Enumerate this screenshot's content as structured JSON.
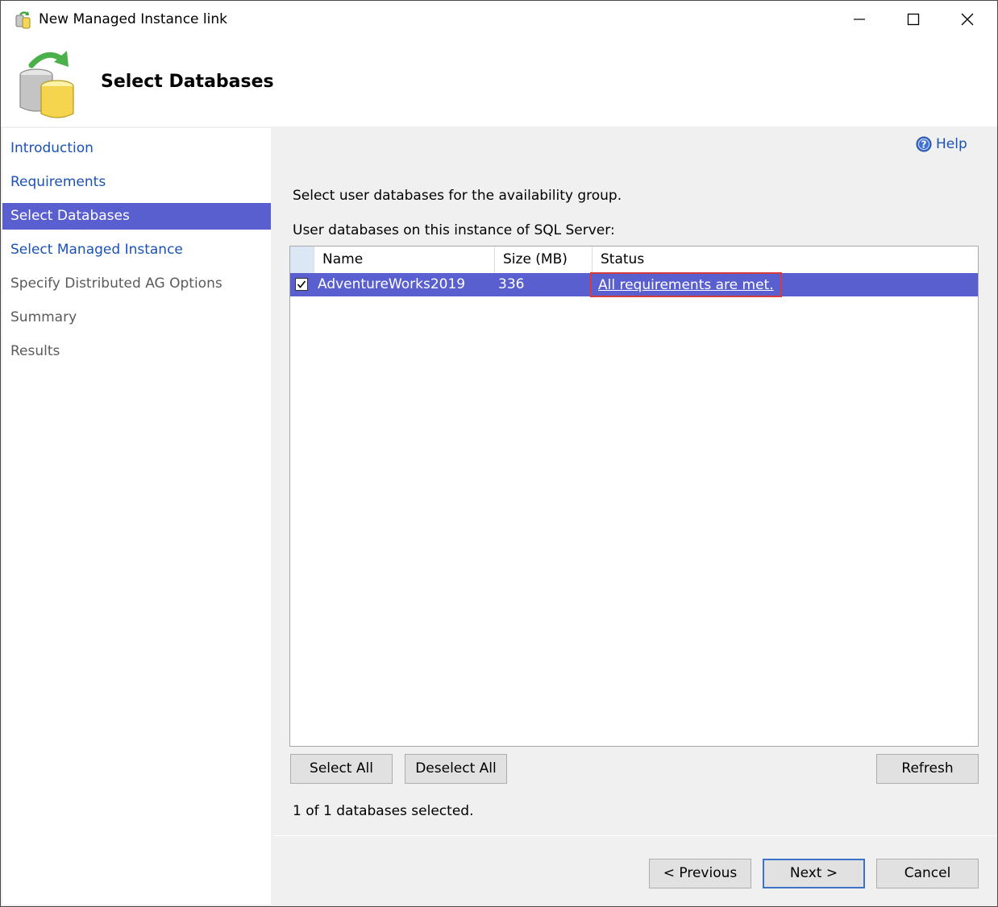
{
  "window": {
    "title": "New Managed Instance link"
  },
  "header": {
    "title": "Select Databases"
  },
  "sidebar": {
    "items": [
      {
        "label": "Introduction",
        "state": "link"
      },
      {
        "label": "Requirements",
        "state": "link"
      },
      {
        "label": "Select Databases",
        "state": "selected"
      },
      {
        "label": "Select Managed Instance",
        "state": "link"
      },
      {
        "label": "Specify Distributed AG Options",
        "state": "disabled"
      },
      {
        "label": "Summary",
        "state": "disabled"
      },
      {
        "label": "Results",
        "state": "disabled"
      }
    ]
  },
  "main": {
    "help_label": "Help",
    "intro": "Select user databases for the availability group.",
    "list_label": "User databases on this instance of SQL Server:",
    "columns": [
      "Name",
      "Size (MB)",
      "Status"
    ],
    "rows": [
      {
        "checked": true,
        "name": "AdventureWorks2019",
        "size": "336",
        "status": "All requirements are met."
      }
    ],
    "select_all_label": "Select All",
    "deselect_all_label": "Deselect All",
    "refresh_label": "Refresh",
    "selected_count": "1 of 1 databases selected."
  },
  "footer": {
    "previous_label": "< Previous",
    "next_label": "Next >",
    "cancel_label": "Cancel"
  },
  "colors": {
    "selection": "#5a5fcf",
    "link": "#1a52b5",
    "highlight_box": "#d63c3c"
  }
}
